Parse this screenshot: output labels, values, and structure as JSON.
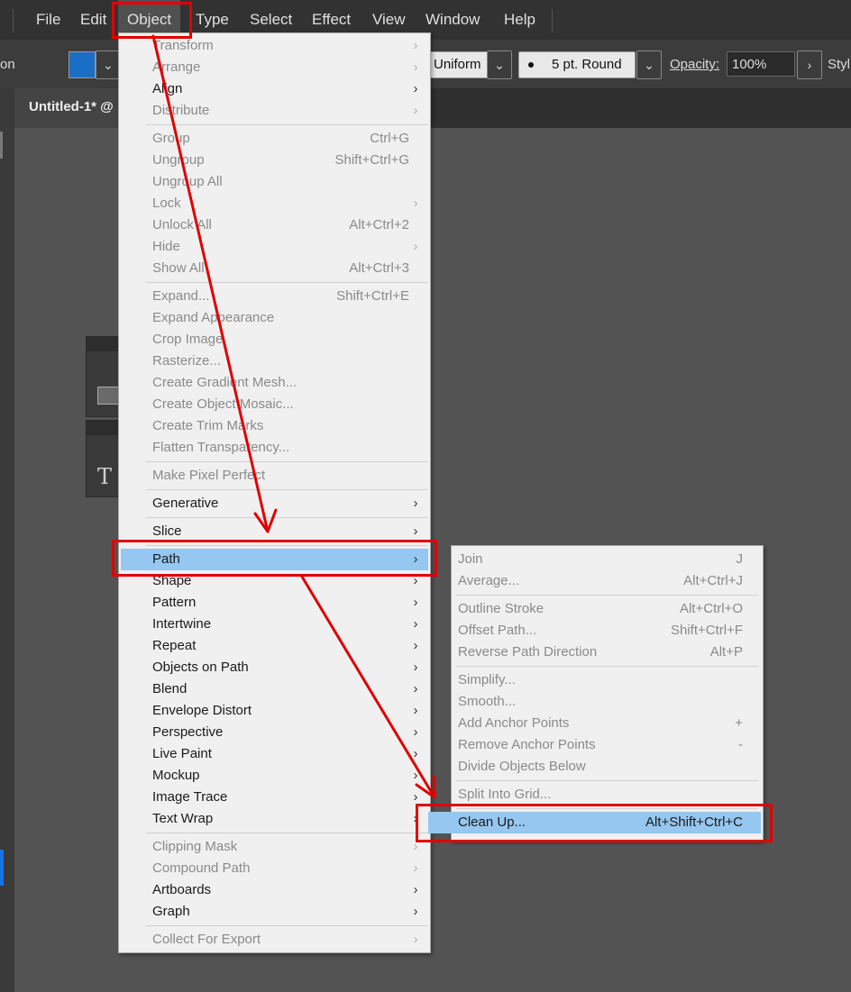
{
  "menubar": {
    "items": [
      "File",
      "Edit",
      "Object",
      "Type",
      "Select",
      "Effect",
      "View",
      "Window",
      "Help"
    ],
    "active": "Object"
  },
  "controlbar": {
    "left_text": "on",
    "fill_color": "#1a6fc4",
    "stroke_profile": "Uniform",
    "brush": "5 pt. Round",
    "opacity_label": "Opacity:",
    "opacity_value": "100%",
    "style_label": "Styl"
  },
  "document": {
    "tab_title": "Untitled-1* @"
  },
  "toolbox": {
    "type_tool_glyph": "T"
  },
  "object_menu": {
    "groups": [
      [
        {
          "label": "Transform",
          "enabled": false,
          "submenu": true
        },
        {
          "label": "Arrange",
          "enabled": false,
          "submenu": true
        },
        {
          "label": "Align",
          "enabled": true,
          "submenu": true
        },
        {
          "label": "Distribute",
          "enabled": false,
          "submenu": true
        }
      ],
      [
        {
          "label": "Group",
          "shortcut": "Ctrl+G",
          "enabled": false
        },
        {
          "label": "Ungroup",
          "shortcut": "Shift+Ctrl+G",
          "enabled": false
        },
        {
          "label": "Ungroup All",
          "enabled": false
        },
        {
          "label": "Lock",
          "enabled": false,
          "submenu": true
        },
        {
          "label": "Unlock All",
          "shortcut": "Alt+Ctrl+2",
          "enabled": false
        },
        {
          "label": "Hide",
          "enabled": false,
          "submenu": true
        },
        {
          "label": "Show All",
          "shortcut": "Alt+Ctrl+3",
          "enabled": false
        }
      ],
      [
        {
          "label": "Expand...",
          "shortcut": "Shift+Ctrl+E",
          "enabled": false
        },
        {
          "label": "Expand Appearance",
          "enabled": false
        },
        {
          "label": "Crop Image",
          "enabled": false
        },
        {
          "label": "Rasterize...",
          "enabled": false
        },
        {
          "label": "Create Gradient Mesh...",
          "enabled": false
        },
        {
          "label": "Create Object Mosaic...",
          "enabled": false
        },
        {
          "label": "Create Trim Marks",
          "enabled": false
        },
        {
          "label": "Flatten Transparency...",
          "enabled": false
        }
      ],
      [
        {
          "label": "Make Pixel Perfect",
          "enabled": false
        }
      ],
      [
        {
          "label": "Generative",
          "enabled": true,
          "submenu": true
        }
      ],
      [
        {
          "label": "Slice",
          "enabled": true,
          "submenu": true
        }
      ],
      [
        {
          "label": "Path",
          "enabled": true,
          "submenu": true,
          "highlighted": true
        },
        {
          "label": "Shape",
          "enabled": true,
          "submenu": true
        },
        {
          "label": "Pattern",
          "enabled": true,
          "submenu": true
        },
        {
          "label": "Intertwine",
          "enabled": true,
          "submenu": true
        },
        {
          "label": "Repeat",
          "enabled": true,
          "submenu": true
        },
        {
          "label": "Objects on Path",
          "enabled": true,
          "submenu": true
        },
        {
          "label": "Blend",
          "enabled": true,
          "submenu": true
        },
        {
          "label": "Envelope Distort",
          "enabled": true,
          "submenu": true
        },
        {
          "label": "Perspective",
          "enabled": true,
          "submenu": true
        },
        {
          "label": "Live Paint",
          "enabled": true,
          "submenu": true
        },
        {
          "label": "Mockup",
          "enabled": true,
          "submenu": true
        },
        {
          "label": "Image Trace",
          "enabled": true,
          "submenu": true
        },
        {
          "label": "Text Wrap",
          "enabled": true,
          "submenu": true
        }
      ],
      [
        {
          "label": "Clipping Mask",
          "enabled": false,
          "submenu": true
        },
        {
          "label": "Compound Path",
          "enabled": false,
          "submenu": true
        },
        {
          "label": "Artboards",
          "enabled": true,
          "submenu": true
        },
        {
          "label": "Graph",
          "enabled": true,
          "submenu": true
        }
      ],
      [
        {
          "label": "Collect For Export",
          "enabled": false,
          "submenu": true
        }
      ]
    ]
  },
  "path_submenu": {
    "groups": [
      [
        {
          "label": "Join",
          "shortcut": "J",
          "enabled": false
        },
        {
          "label": "Average...",
          "shortcut": "Alt+Ctrl+J",
          "enabled": false
        }
      ],
      [
        {
          "label": "Outline Stroke",
          "shortcut": "Alt+Ctrl+O",
          "enabled": false
        },
        {
          "label": "Offset Path...",
          "shortcut": "Shift+Ctrl+F",
          "enabled": false
        },
        {
          "label": "Reverse Path Direction",
          "shortcut": "Alt+P",
          "enabled": false
        }
      ],
      [
        {
          "label": "Simplify...",
          "enabled": false
        },
        {
          "label": "Smooth...",
          "enabled": false
        },
        {
          "label": "Add Anchor Points",
          "shortcut": "+",
          "enabled": false
        },
        {
          "label": "Remove Anchor Points",
          "shortcut": "-",
          "enabled": false
        },
        {
          "label": "Divide Objects Below",
          "enabled": false
        }
      ],
      [
        {
          "label": "Split Into Grid...",
          "enabled": false
        }
      ],
      [
        {
          "label": "Clean Up...",
          "shortcut": "Alt+Shift+Ctrl+C",
          "enabled": true,
          "highlighted": true
        }
      ]
    ]
  },
  "annotations": {
    "highlight_color": "#e00000",
    "highlighted_items": [
      "Object",
      "Path",
      "Clean Up..."
    ]
  }
}
